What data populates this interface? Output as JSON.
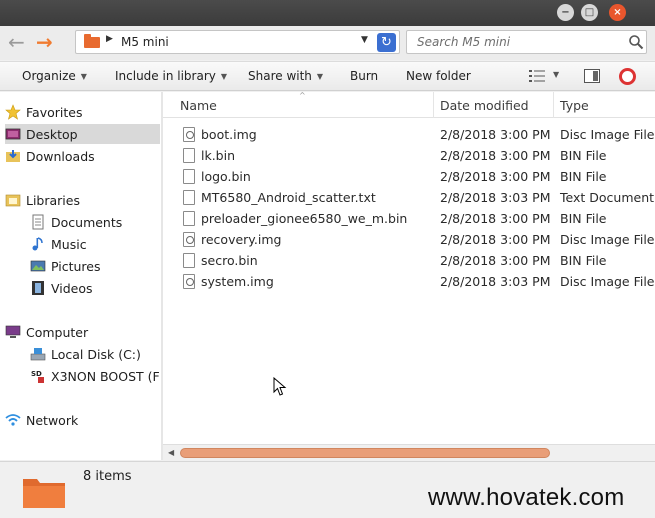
{
  "window": {
    "controls": [
      "−",
      "□",
      "×"
    ]
  },
  "address": {
    "path": "M5 mini",
    "search_placeholder": "Search M5 mini"
  },
  "toolbar": {
    "organize": "Organize",
    "include_in_library": "Include in library",
    "share_with": "Share with",
    "burn": "Burn",
    "new_folder": "New folder"
  },
  "nav": {
    "favorites": "Favorites",
    "desktop": "Desktop",
    "downloads": "Downloads",
    "libraries": "Libraries",
    "documents": "Documents",
    "music": "Music",
    "pictures": "Pictures",
    "videos": "Videos",
    "computer": "Computer",
    "local_disk": "Local Disk (C:)",
    "x3non": "X3NON BOOST (F",
    "network": "Network"
  },
  "columns": {
    "name": "Name",
    "date": "Date modified",
    "type": "Type"
  },
  "files": [
    {
      "name": "boot.img",
      "date": "2/8/2018 3:00 PM",
      "type": "Disc Image File",
      "icon": "disc-image-icon"
    },
    {
      "name": "lk.bin",
      "date": "2/8/2018 3:00 PM",
      "type": "BIN File",
      "icon": "file-icon"
    },
    {
      "name": "logo.bin",
      "date": "2/8/2018 3:00 PM",
      "type": "BIN File",
      "icon": "file-icon"
    },
    {
      "name": "MT6580_Android_scatter.txt",
      "date": "2/8/2018 3:03 PM",
      "type": "Text Document",
      "icon": "text-file-icon"
    },
    {
      "name": "preloader_gionee6580_we_m.bin",
      "date": "2/8/2018 3:00 PM",
      "type": "BIN File",
      "icon": "file-icon"
    },
    {
      "name": "recovery.img",
      "date": "2/8/2018 3:00 PM",
      "type": "Disc Image File",
      "icon": "disc-image-icon"
    },
    {
      "name": "secro.bin",
      "date": "2/8/2018 3:00 PM",
      "type": "BIN File",
      "icon": "file-icon"
    },
    {
      "name": "system.img",
      "date": "2/8/2018 3:03 PM",
      "type": "Disc Image File",
      "icon": "disc-image-icon"
    }
  ],
  "status": {
    "count": "8 items"
  },
  "watermark": "www.hovatek.com",
  "colors": {
    "accent_orange": "#e86a2f",
    "selected_bg": "#d9d9d9",
    "refresh_blue": "#3b6fd1"
  }
}
